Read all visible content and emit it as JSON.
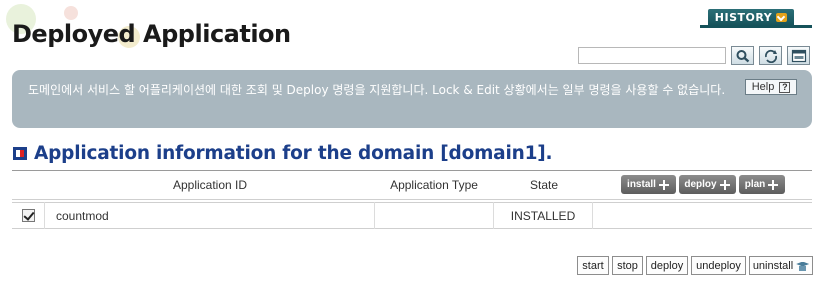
{
  "header": {
    "page_title": "Deployed Application",
    "history_label": "HISTORY"
  },
  "toolbar": {
    "search_value": "",
    "icons": [
      "search-icon",
      "refresh-icon",
      "export-xml-icon"
    ]
  },
  "description": {
    "text": "도메인에서 서비스 할 어플리케이션에 대한 조회 및 Deploy 명령을 지원합니다. Lock & Edit 상황에서는 일부 명령을 사용할 수 없습니다.",
    "help_label": "Help"
  },
  "section": {
    "title": "Application information for the domain [domain1]."
  },
  "table": {
    "columns": [
      "Application ID",
      "Application Type",
      "State"
    ],
    "actions": [
      "install",
      "deploy",
      "plan"
    ],
    "rows": [
      {
        "checked": true,
        "id": "countmod",
        "type": "",
        "state": "INSTALLED"
      }
    ]
  },
  "bottom_buttons": [
    "start",
    "stop",
    "deploy",
    "undeploy",
    "uninstall"
  ],
  "colors": {
    "history_bg": "#15525a",
    "desc_bg": "#a9b7bf",
    "section_title": "#1c3f8a",
    "action_btn": "#6e6e6e"
  }
}
